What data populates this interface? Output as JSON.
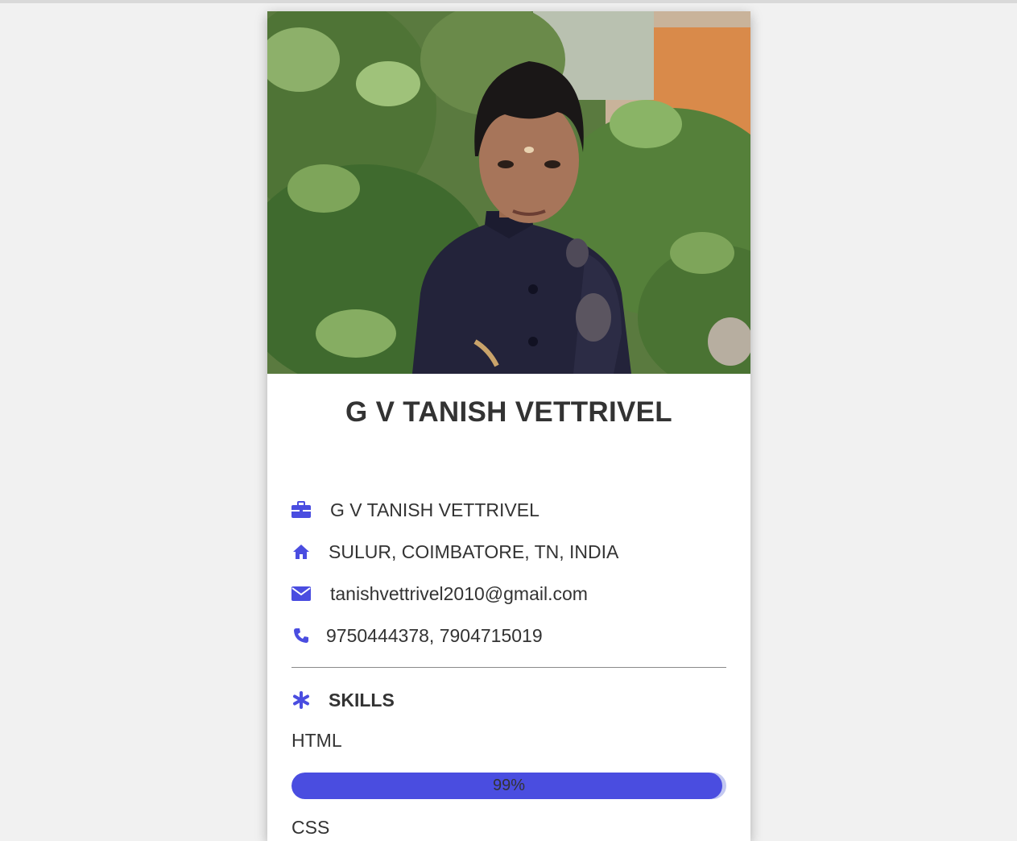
{
  "profile": {
    "name": "G V TANISH VETTRIVEL",
    "photo_alt": ""
  },
  "info": {
    "job": "G V TANISH VETTRIVEL",
    "address": "SULUR, COIMBATORE, TN, INDIA",
    "email": "tanishvettrivel2010@gmail.com",
    "phone": "9750444378, 7904715019"
  },
  "icons": {
    "job": "briefcase-icon",
    "address": "home-icon",
    "email": "envelope-icon",
    "phone": "phone-icon",
    "skills": "asterisk-icon"
  },
  "skills": {
    "heading": "SKILLS",
    "items": [
      {
        "label": "HTML",
        "percent_text": "99%",
        "fraction": 0.99
      },
      {
        "label": "CSS"
      }
    ]
  },
  "colors": {
    "accent": "#4a4de0",
    "accent_light": "#c3c8f1",
    "text": "#333333",
    "background": "#f1f1f1"
  }
}
